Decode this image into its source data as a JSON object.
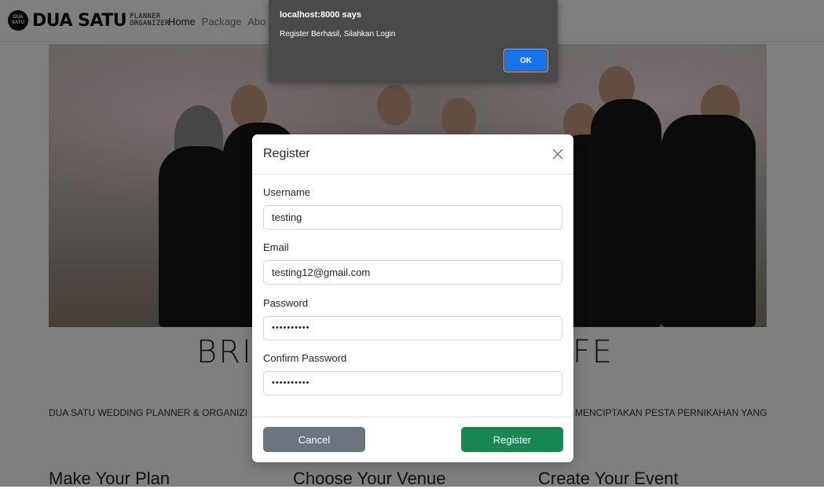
{
  "nav": {
    "logo_badge": "DUA SATU",
    "logo_word": "DUA SATU",
    "logo_sub_1": "PLANNER",
    "logo_sub_2": "ORGANIZER",
    "links": [
      "Home",
      "Package",
      "Abo"
    ]
  },
  "hero": {
    "title_left": "BRI",
    "title_right": "IFE"
  },
  "content": {
    "desc_left": "DUA SATU WEDDING PLANNER & ORGANIZI",
    "desc_right": "MENCIPTAKAN PESTA PERNIKAHAN YANG",
    "sections": [
      "Make Your Plan",
      "Choose Your Venue",
      "Create Your Event"
    ]
  },
  "alert": {
    "title": "localhost:8000 says",
    "message": "Register Berhasil, Silahkan Login",
    "ok_label": "OK"
  },
  "modal": {
    "title": "Register",
    "username_label": "Username",
    "username_value": "testing",
    "email_label": "Email",
    "email_value": "testing12@gmail.com",
    "password_label": "Password",
    "password_value": "••••••••••",
    "confirm_label": "Confirm Password",
    "confirm_value": "••••••••••",
    "cancel_label": "Cancel",
    "register_label": "Register"
  },
  "colors": {
    "primary_button": "#1a73e8",
    "register_button": "#198754",
    "cancel_button": "#6c757d"
  }
}
